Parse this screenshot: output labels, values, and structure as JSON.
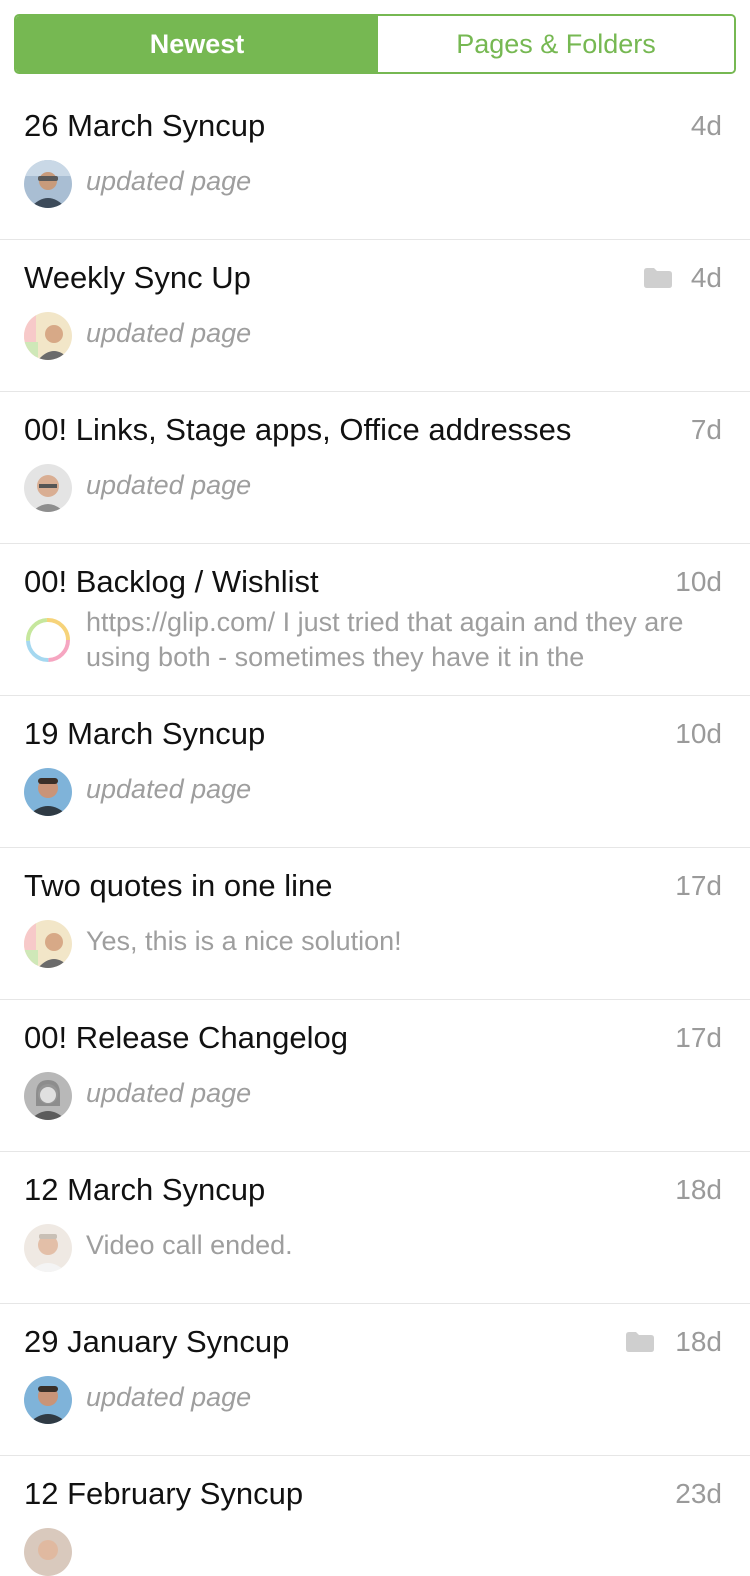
{
  "tabs": {
    "newest": "Newest",
    "pages_folders": "Pages & Folders"
  },
  "items": [
    {
      "title": "26 March Syncup",
      "time": "4d",
      "preview": "updated page"
    },
    {
      "title": "Weekly Sync Up",
      "time": "4d",
      "preview": "updated page"
    },
    {
      "title": "00! Links, Stage apps, Office addresses",
      "time": "7d",
      "preview": "updated page"
    },
    {
      "title": "00! Backlog / Wishlist",
      "time": "10d",
      "preview": "https://glip.com/ I just tried that again and they are using both - sometimes they have it in the"
    },
    {
      "title": "19 March Syncup",
      "time": "10d",
      "preview": "updated page"
    },
    {
      "title": "Two quotes in one line",
      "time": "17d",
      "preview": "Yes, this is a nice solution!"
    },
    {
      "title": "00! Release Changelog",
      "time": "17d",
      "preview": "updated page"
    },
    {
      "title": "12 March Syncup",
      "time": "18d",
      "preview": "Video call ended."
    },
    {
      "title": "29 January Syncup",
      "time": "18d",
      "preview": "updated page"
    },
    {
      "title": "12 February Syncup",
      "time": "23d",
      "preview": ""
    }
  ],
  "colors": {
    "accent": "#76b852",
    "muted": "#9e9e9e"
  }
}
